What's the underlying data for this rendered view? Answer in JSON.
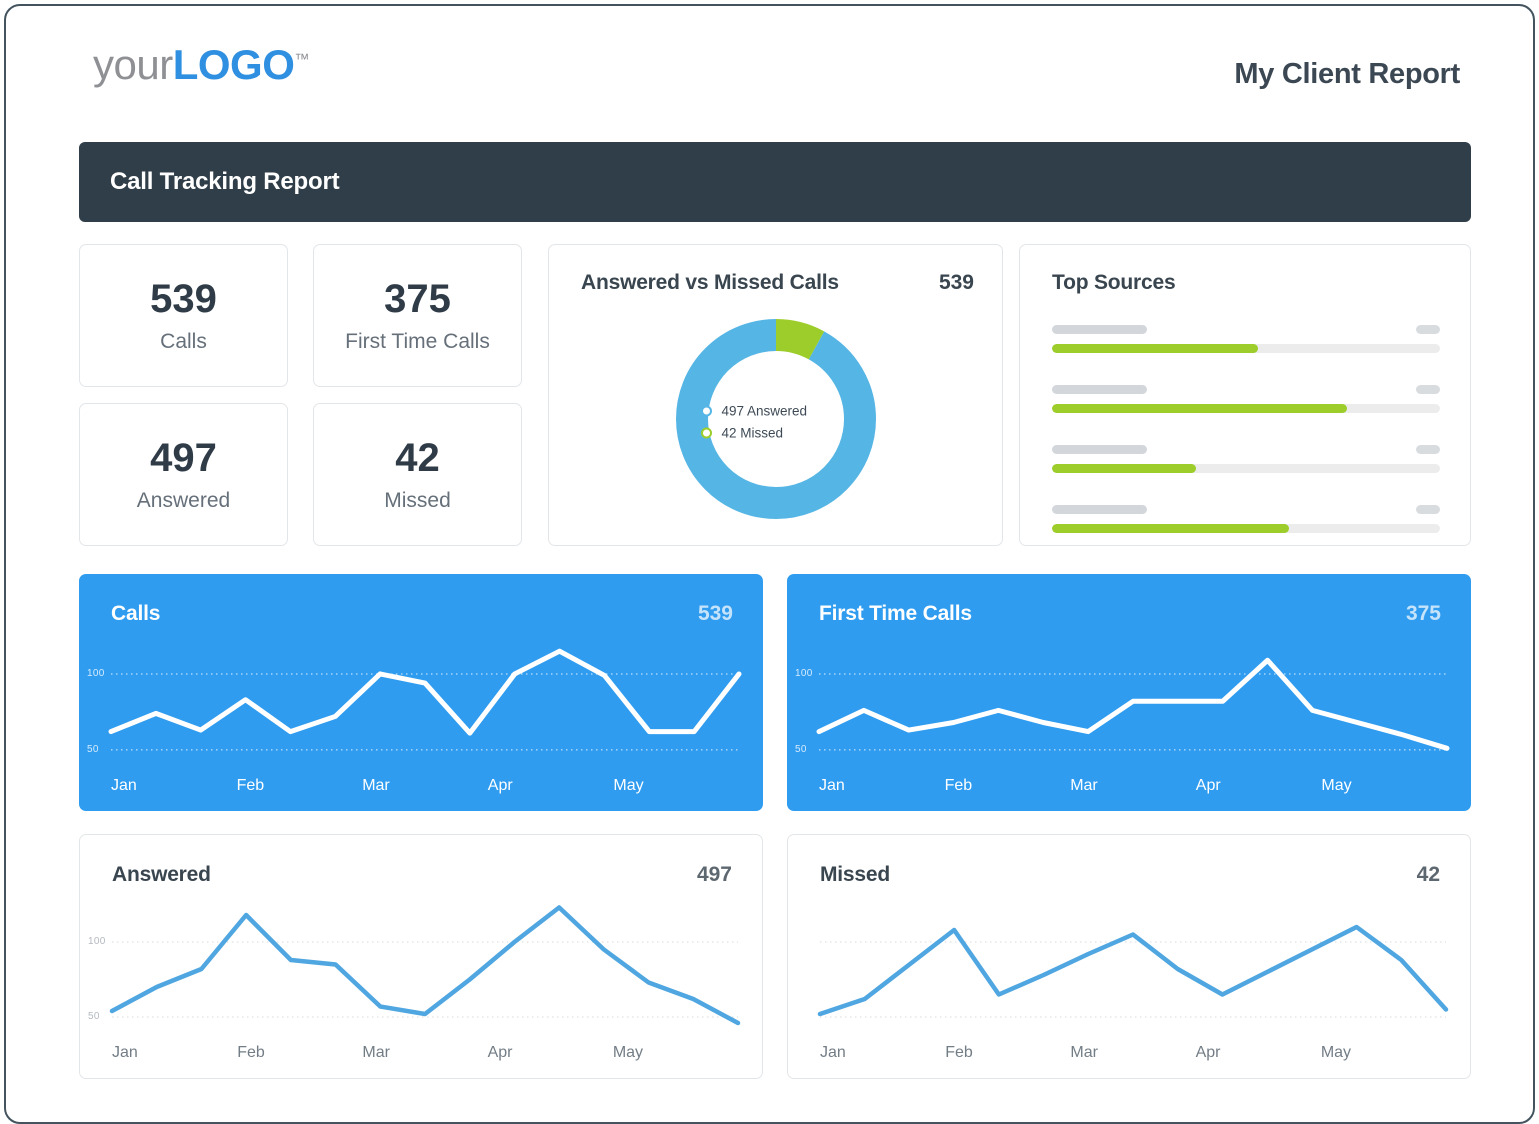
{
  "header": {
    "logo_your": "your",
    "logo_logo": "LOGO",
    "logo_tm": "™",
    "report_title": "My Client Report"
  },
  "banner": {
    "title": "Call Tracking Report"
  },
  "kpis": [
    {
      "value": "539",
      "label": "Calls"
    },
    {
      "value": "375",
      "label": "First Time Calls"
    },
    {
      "value": "497",
      "label": "Answered"
    },
    {
      "value": "42",
      "label": "Missed"
    }
  ],
  "donut_panel": {
    "title": "Answered vs Missed Calls",
    "total": "539",
    "legend": [
      {
        "label": "497 Answered",
        "color": "#55b5e5"
      },
      {
        "label": "42 Missed",
        "color": "#9ccd2a"
      }
    ]
  },
  "top_sources": {
    "title": "Top Sources",
    "rows": [
      {
        "fill_percent": 53
      },
      {
        "fill_percent": 76
      },
      {
        "fill_percent": 37
      },
      {
        "fill_percent": 61
      }
    ],
    "bar_color": "#9ccd2a",
    "track_color": "#ececec"
  },
  "colors": {
    "accent_blue": "#2f9cf0",
    "donut_blue": "#55b5e5",
    "green": "#9ccd2a",
    "dark": "#303e49",
    "line_blue": "#4fa6e0"
  },
  "chart_data": [
    {
      "type": "line",
      "title": "Calls",
      "total": "539",
      "theme": "blue",
      "xlabel": "",
      "ylabel": "",
      "categories": [
        "Jan",
        "Feb",
        "Mar",
        "Apr",
        "May"
      ],
      "xticks": [
        "Jan",
        "Feb",
        "Mar",
        "Apr",
        "May"
      ],
      "yticks": [
        50,
        100
      ],
      "ytick_labels": [
        "50",
        "100"
      ],
      "ylim": [
        40,
        125
      ],
      "grid": true,
      "legend": "none",
      "values": [
        62,
        74,
        63,
        83,
        62,
        72,
        100,
        94,
        61,
        100,
        115,
        99,
        62,
        62,
        100
      ],
      "x": [
        0,
        1,
        2,
        3,
        4,
        5,
        6,
        7,
        8,
        9,
        10,
        11,
        12,
        13,
        14
      ]
    },
    {
      "type": "line",
      "title": "First Time Calls",
      "total": "375",
      "theme": "blue",
      "xlabel": "",
      "ylabel": "",
      "categories": [
        "Jan",
        "Feb",
        "Mar",
        "Apr",
        "May"
      ],
      "xticks": [
        "Jan",
        "Feb",
        "Mar",
        "Apr",
        "May"
      ],
      "yticks": [
        50,
        100
      ],
      "ytick_labels": [
        "50",
        "100"
      ],
      "ylim": [
        40,
        125
      ],
      "grid": true,
      "legend": "none",
      "values": [
        62,
        76,
        63,
        68,
        76,
        68,
        62,
        82,
        82,
        82,
        109,
        76,
        68,
        60,
        51
      ],
      "x": [
        0,
        1,
        2,
        3,
        4,
        5,
        6,
        7,
        8,
        9,
        10,
        11,
        12,
        13,
        14
      ]
    },
    {
      "type": "line",
      "title": "Answered",
      "total": "497",
      "theme": "white",
      "xlabel": "",
      "ylabel": "",
      "categories": [
        "Jan",
        "Feb",
        "Mar",
        "Apr",
        "May"
      ],
      "xticks": [
        "Jan",
        "Feb",
        "Mar",
        "Apr",
        "May"
      ],
      "yticks": [
        50,
        100
      ],
      "ytick_labels": [
        "50",
        "100"
      ],
      "ylim": [
        40,
        130
      ],
      "grid": true,
      "legend": "none",
      "values": [
        54,
        70,
        82,
        118,
        88,
        85,
        57,
        52,
        75,
        100,
        123,
        95,
        73,
        62,
        46
      ],
      "x": [
        0,
        1,
        2,
        3,
        4,
        5,
        6,
        7,
        8,
        9,
        10,
        11,
        12,
        13,
        14
      ]
    },
    {
      "type": "line",
      "title": "Missed",
      "total": "42",
      "theme": "white",
      "xlabel": "",
      "ylabel": "",
      "categories": [
        "Jan",
        "Feb",
        "Mar",
        "Apr",
        "May"
      ],
      "xticks": [
        "Jan",
        "Feb",
        "Mar",
        "Apr",
        "May"
      ],
      "yticks": [],
      "ytick_labels": [],
      "ylim": [
        40,
        130
      ],
      "grid": true,
      "legend": "none",
      "values": [
        52,
        62,
        85,
        108,
        65,
        78,
        92,
        105,
        82,
        65,
        80,
        95,
        110,
        88,
        55
      ],
      "x": [
        0,
        1,
        2,
        3,
        4,
        5,
        6,
        7,
        8,
        9,
        10,
        11,
        12,
        13,
        14
      ]
    }
  ],
  "donut_chart": {
    "type": "pie",
    "title": "Answered vs Missed Calls",
    "labels": [
      "Answered",
      "Missed"
    ],
    "values": [
      497,
      42
    ],
    "colors": [
      "#55b5e5",
      "#9ccd2a"
    ],
    "total": 539,
    "donut": true
  }
}
